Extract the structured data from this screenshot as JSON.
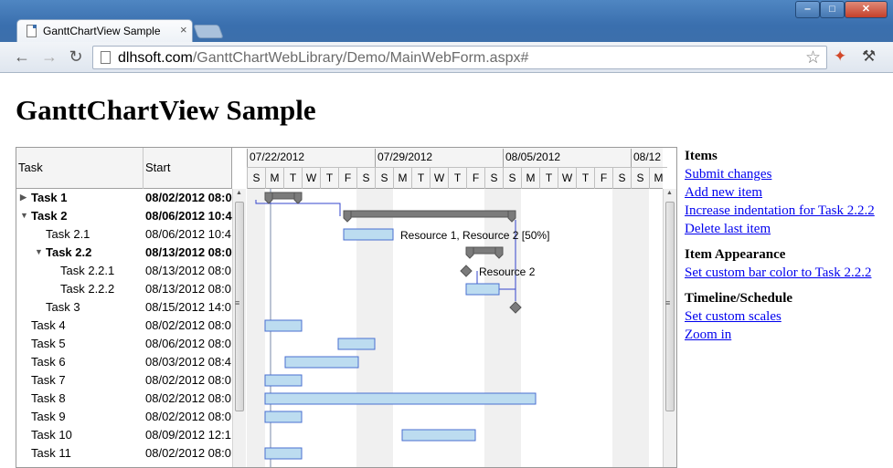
{
  "browser": {
    "tab_title": "GanttChartView Sample",
    "tab_close": "×",
    "url_host": "dlhsoft.com",
    "url_path": "/GanttChartWebLibrary/Demo/MainWebForm.aspx#",
    "window_min": "‒",
    "window_max": "□",
    "window_close": "✕"
  },
  "page": {
    "title": "GanttChartView Sample"
  },
  "grid": {
    "columns": {
      "task": "Task",
      "start": "Start"
    },
    "rows": [
      {
        "name": "Task 1",
        "start": "08/02/2012 08:0",
        "bold": true,
        "indent": 0,
        "toggle": "collapsed"
      },
      {
        "name": "Task 2",
        "start": "08/06/2012 10:4",
        "bold": true,
        "indent": 0,
        "toggle": "expanded"
      },
      {
        "name": "Task 2.1",
        "start": "08/06/2012 10:4",
        "bold": false,
        "indent": 1,
        "toggle": ""
      },
      {
        "name": "Task 2.2",
        "start": "08/13/2012 08:0",
        "bold": true,
        "indent": 1,
        "toggle": "expanded"
      },
      {
        "name": "Task 2.2.1",
        "start": "08/13/2012 08:0",
        "bold": false,
        "indent": 2,
        "toggle": ""
      },
      {
        "name": "Task 2.2.2",
        "start": "08/13/2012 08:0",
        "bold": false,
        "indent": 2,
        "toggle": ""
      },
      {
        "name": "Task 3",
        "start": "08/15/2012 14:0",
        "bold": false,
        "indent": 1,
        "toggle": ""
      },
      {
        "name": "Task 4",
        "start": "08/02/2012 08:0",
        "bold": false,
        "indent": 0,
        "toggle": ""
      },
      {
        "name": "Task 5",
        "start": "08/06/2012 08:0",
        "bold": false,
        "indent": 0,
        "toggle": ""
      },
      {
        "name": "Task 6",
        "start": "08/03/2012 08:4",
        "bold": false,
        "indent": 0,
        "toggle": ""
      },
      {
        "name": "Task 7",
        "start": "08/02/2012 08:0",
        "bold": false,
        "indent": 0,
        "toggle": ""
      },
      {
        "name": "Task 8",
        "start": "08/02/2012 08:0",
        "bold": false,
        "indent": 0,
        "toggle": ""
      },
      {
        "name": "Task 9",
        "start": "08/02/2012 08:0",
        "bold": false,
        "indent": 0,
        "toggle": ""
      },
      {
        "name": "Task 10",
        "start": "08/09/2012 12:1",
        "bold": false,
        "indent": 0,
        "toggle": ""
      },
      {
        "name": "Task 11",
        "start": "08/02/2012 08:0",
        "bold": false,
        "indent": 0,
        "toggle": ""
      }
    ]
  },
  "timeline": {
    "weeks": [
      "07/22/2012",
      "07/29/2012",
      "08/05/2012",
      "08/12"
    ],
    "days": [
      "S",
      "M",
      "T",
      "W",
      "T",
      "F",
      "S",
      "S",
      "M",
      "T",
      "W",
      "T",
      "F",
      "S",
      "S",
      "M",
      "T",
      "W",
      "T",
      "F",
      "S",
      "S",
      "M"
    ],
    "weekend_days": [
      0,
      6,
      7,
      13,
      14,
      20,
      21
    ],
    "today_day": 1.3,
    "bars": [
      {
        "row": 0,
        "kind": "summary",
        "from": 1.0,
        "to": 3.0
      },
      {
        "row": 1,
        "kind": "summary",
        "from": 5.3,
        "to": 14.7
      },
      {
        "row": 2,
        "kind": "task",
        "from": 5.3,
        "to": 8.0,
        "label": "Resource 1, Resource 2 [50%]"
      },
      {
        "row": 3,
        "kind": "summary",
        "from": 12.0,
        "to": 14.0
      },
      {
        "row": 4,
        "kind": "milestone",
        "at": 12.0,
        "label": "Resource 2"
      },
      {
        "row": 5,
        "kind": "task",
        "from": 12.0,
        "to": 13.8
      },
      {
        "row": 6,
        "kind": "milestone",
        "at": 14.7
      },
      {
        "row": 7,
        "kind": "task",
        "from": 1.0,
        "to": 3.0
      },
      {
        "row": 8,
        "kind": "task",
        "from": 5.0,
        "to": 7.0
      },
      {
        "row": 9,
        "kind": "task",
        "from": 2.1,
        "to": 6.1
      },
      {
        "row": 10,
        "kind": "task",
        "from": 1.0,
        "to": 3.0
      },
      {
        "row": 11,
        "kind": "task",
        "from": 1.0,
        "to": 15.8
      },
      {
        "row": 12,
        "kind": "task",
        "from": 1.0,
        "to": 3.0
      },
      {
        "row": 13,
        "kind": "task",
        "from": 8.5,
        "to": 12.5
      },
      {
        "row": 14,
        "kind": "task",
        "from": 1.0,
        "to": 3.0
      }
    ]
  },
  "colors": {
    "task_fill": "#bcdcf0",
    "task_stroke": "#4a6fd0",
    "summary_fill": "#7b7b7b",
    "weekend": "#f0f0f0",
    "dependency": "#3344cc",
    "link": "#0000ee"
  },
  "side": {
    "items_heading": "Items",
    "submit_changes": "Submit changes",
    "add_new_item": "Add new item",
    "increase_indentation": "Increase indentation for Task 2.2.2",
    "delete_last_item": "Delete last item",
    "appearance_heading": "Item Appearance",
    "set_custom_bar_color": "Set custom bar color to Task 2.2.2",
    "timeline_heading": "Timeline/Schedule",
    "set_custom_scales": "Set custom scales",
    "zoom_in": "Zoom in"
  }
}
